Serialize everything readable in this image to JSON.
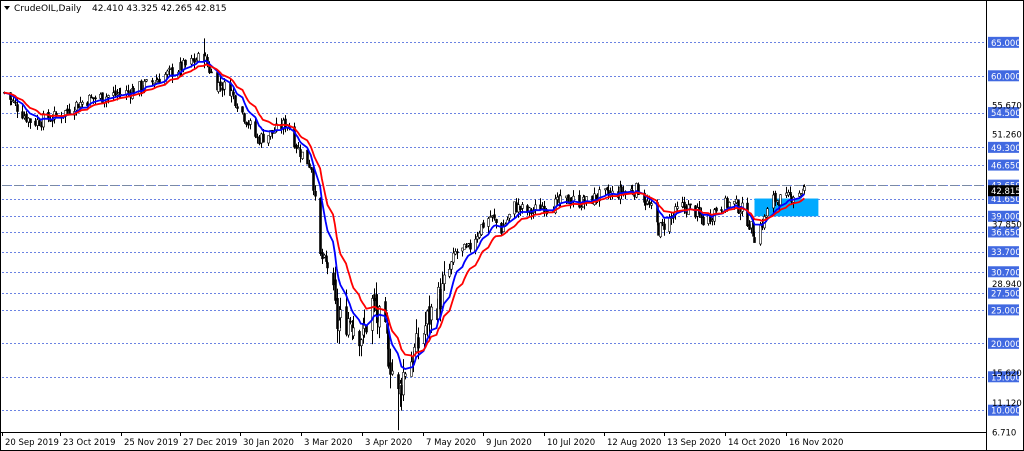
{
  "header": {
    "symbol_label": "CrudeOIL,Daily",
    "ohlc": "42.410 43.325 42.265 42.815"
  },
  "chart_data": {
    "type": "candlestick",
    "title": "CrudeOIL,Daily",
    "ohlc_last": {
      "open": 42.41,
      "high": 43.325,
      "low": 42.265,
      "close": 42.815
    },
    "x_ticks": [
      "20 Sep 2019",
      "23 Oct 2019",
      "25 Nov 2019",
      "27 Dec 2019",
      "30 Jan 2020",
      "3 Mar 2020",
      "3 Apr 2020",
      "7 May 2020",
      "9 Jun 2020",
      "10 Jul 2020",
      "12 Aug 2020",
      "13 Sep 2020",
      "14 Oct 2020",
      "16 Nov 2020"
    ],
    "y_ticks": [
      6.71,
      11.12,
      15.62,
      20.0,
      25.0,
      28.94,
      33.7,
      37.85,
      42.815,
      46.65,
      51.26,
      55.67,
      60.0,
      65.0
    ],
    "h_levels_boxed": [
      65.0,
      60.0,
      54.5,
      49.3,
      46.65,
      43.65,
      41.65,
      39.0,
      36.65,
      33.7,
      30.7,
      27.5,
      25.0,
      20.0,
      15.0,
      10.0
    ],
    "h_levels_plain": [
      55.67,
      51.26,
      37.85,
      28.94,
      15.62,
      11.12,
      6.71
    ],
    "current_price": 42.815,
    "current_price_label": "42.815",
    "ylim": [
      5.0,
      68.5
    ],
    "grid": false,
    "level_color": "#3b5bd9",
    "box_color": "#4169e1",
    "highlight_box": {
      "from_date": "2020-10-30",
      "to_date": "2020-11-26",
      "low": 39.0,
      "high": 41.65,
      "color": "#00aaff"
    },
    "series": [
      {
        "name": "",
        "color": "#0000ff"
      },
      {
        "name": "",
        "color": "#ff0000"
      }
    ],
    "path": [
      {
        "d": "2019-09-20",
        "p": 57.5
      },
      {
        "d": "2019-09-28",
        "p": 55.0
      },
      {
        "d": "2019-10-05",
        "p": 53.0
      },
      {
        "d": "2019-10-12",
        "p": 53.5
      },
      {
        "d": "2019-10-20",
        "p": 54.0
      },
      {
        "d": "2019-10-27",
        "p": 55.5
      },
      {
        "d": "2019-11-05",
        "p": 56.5
      },
      {
        "d": "2019-11-15",
        "p": 57.0
      },
      {
        "d": "2019-11-25",
        "p": 57.5
      },
      {
        "d": "2019-12-05",
        "p": 58.5
      },
      {
        "d": "2019-12-15",
        "p": 60.0
      },
      {
        "d": "2019-12-27",
        "p": 61.5
      },
      {
        "d": "2020-01-06",
        "p": 63.0
      },
      {
        "d": "2020-01-12",
        "p": 59.0
      },
      {
        "d": "2020-01-20",
        "p": 58.0
      },
      {
        "d": "2020-01-28",
        "p": 54.0
      },
      {
        "d": "2020-02-04",
        "p": 50.5
      },
      {
        "d": "2020-02-12",
        "p": 51.5
      },
      {
        "d": "2020-02-20",
        "p": 53.0
      },
      {
        "d": "2020-02-26",
        "p": 49.0
      },
      {
        "d": "2020-03-04",
        "p": 46.5
      },
      {
        "d": "2020-03-09",
        "p": 33.0
      },
      {
        "d": "2020-03-13",
        "p": 31.5
      },
      {
        "d": "2020-03-18",
        "p": 23.0
      },
      {
        "d": "2020-03-25",
        "p": 24.0
      },
      {
        "d": "2020-04-01",
        "p": 21.0
      },
      {
        "d": "2020-04-06",
        "p": 26.0
      },
      {
        "d": "2020-04-14",
        "p": 20.0
      },
      {
        "d": "2020-04-20",
        "p": 12.0
      },
      {
        "d": "2020-04-24",
        "p": 16.5
      },
      {
        "d": "2020-04-30",
        "p": 19.0
      },
      {
        "d": "2020-05-07",
        "p": 24.0
      },
      {
        "d": "2020-05-14",
        "p": 27.5
      },
      {
        "d": "2020-05-21",
        "p": 33.5
      },
      {
        "d": "2020-05-28",
        "p": 34.0
      },
      {
        "d": "2020-06-04",
        "p": 37.5
      },
      {
        "d": "2020-06-09",
        "p": 39.0
      },
      {
        "d": "2020-06-15",
        "p": 37.0
      },
      {
        "d": "2020-06-22",
        "p": 40.5
      },
      {
        "d": "2020-06-30",
        "p": 39.5
      },
      {
        "d": "2020-07-06",
        "p": 40.5
      },
      {
        "d": "2020-07-14",
        "p": 40.8
      },
      {
        "d": "2020-07-22",
        "p": 41.5
      },
      {
        "d": "2020-07-30",
        "p": 41.0
      },
      {
        "d": "2020-08-06",
        "p": 42.0
      },
      {
        "d": "2020-08-14",
        "p": 42.3
      },
      {
        "d": "2020-08-22",
        "p": 42.8
      },
      {
        "d": "2020-08-28",
        "p": 43.0
      },
      {
        "d": "2020-09-04",
        "p": 40.0
      },
      {
        "d": "2020-09-08",
        "p": 37.0
      },
      {
        "d": "2020-09-14",
        "p": 38.5
      },
      {
        "d": "2020-09-20",
        "p": 40.5
      },
      {
        "d": "2020-09-27",
        "p": 40.0
      },
      {
        "d": "2020-10-03",
        "p": 38.0
      },
      {
        "d": "2020-10-10",
        "p": 40.5
      },
      {
        "d": "2020-10-18",
        "p": 41.0
      },
      {
        "d": "2020-10-24",
        "p": 39.8
      },
      {
        "d": "2020-10-30",
        "p": 36.0
      },
      {
        "d": "2020-11-04",
        "p": 38.5
      },
      {
        "d": "2020-11-09",
        "p": 41.5
      },
      {
        "d": "2020-11-16",
        "p": 41.5
      },
      {
        "d": "2020-11-21",
        "p": 42.5
      },
      {
        "d": "2020-11-26",
        "p": 42.8
      }
    ]
  }
}
